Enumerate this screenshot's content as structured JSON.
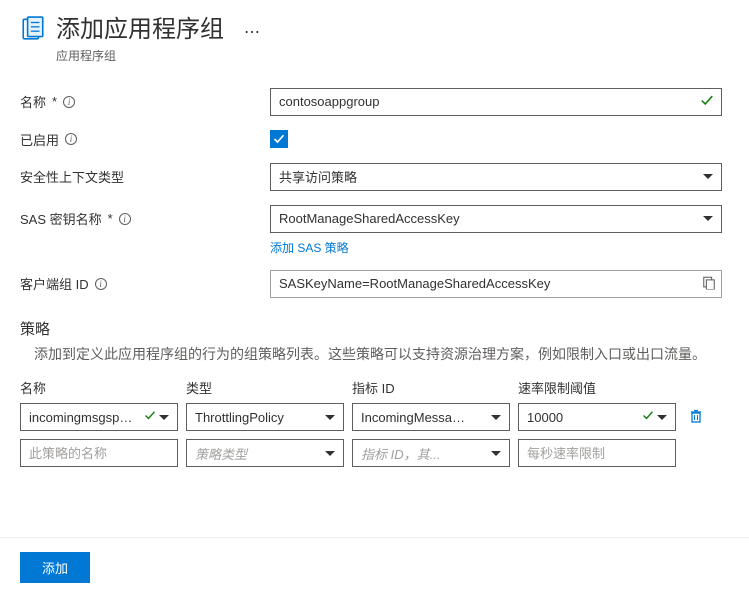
{
  "header": {
    "title": "添加应用程序组",
    "subtitle": "应用程序组",
    "more_icon": "⋯"
  },
  "fields": {
    "name": {
      "label": "名称",
      "required": "*",
      "value": "contosoappgroup"
    },
    "enabled": {
      "label": "已启用",
      "checked": true
    },
    "security_context_type": {
      "label": "安全性上下文类型",
      "value": "共享访问策略"
    },
    "sas_key_name": {
      "label": "SAS 密钥名称",
      "required": "*",
      "value": "RootManageSharedAccessKey",
      "add_link": "添加 SAS 策略"
    },
    "client_group_id": {
      "label": "客户端组 ID",
      "value": "SASKeyName=RootManageSharedAccessKey"
    }
  },
  "policies": {
    "section_title": "策略",
    "section_desc": "添加到定义此应用程序组的行为的组策略列表。这些策略可以支持资源治理方案，例如限制入口或出口流量。",
    "headers": {
      "name": "名称",
      "type": "类型",
      "metric": "指标 ID",
      "threshold": "速率限制阈值"
    },
    "rows": [
      {
        "name": "incomingmsgspolicy",
        "type": "ThrottlingPolicy",
        "metric": "IncomingMessages",
        "threshold": "10000",
        "valid": true
      }
    ],
    "placeholders": {
      "name": "此策略的名称",
      "type": "策略类型",
      "metric": "指标 ID，其...",
      "threshold": "每秒速率限制"
    }
  },
  "footer": {
    "submit": "添加"
  }
}
